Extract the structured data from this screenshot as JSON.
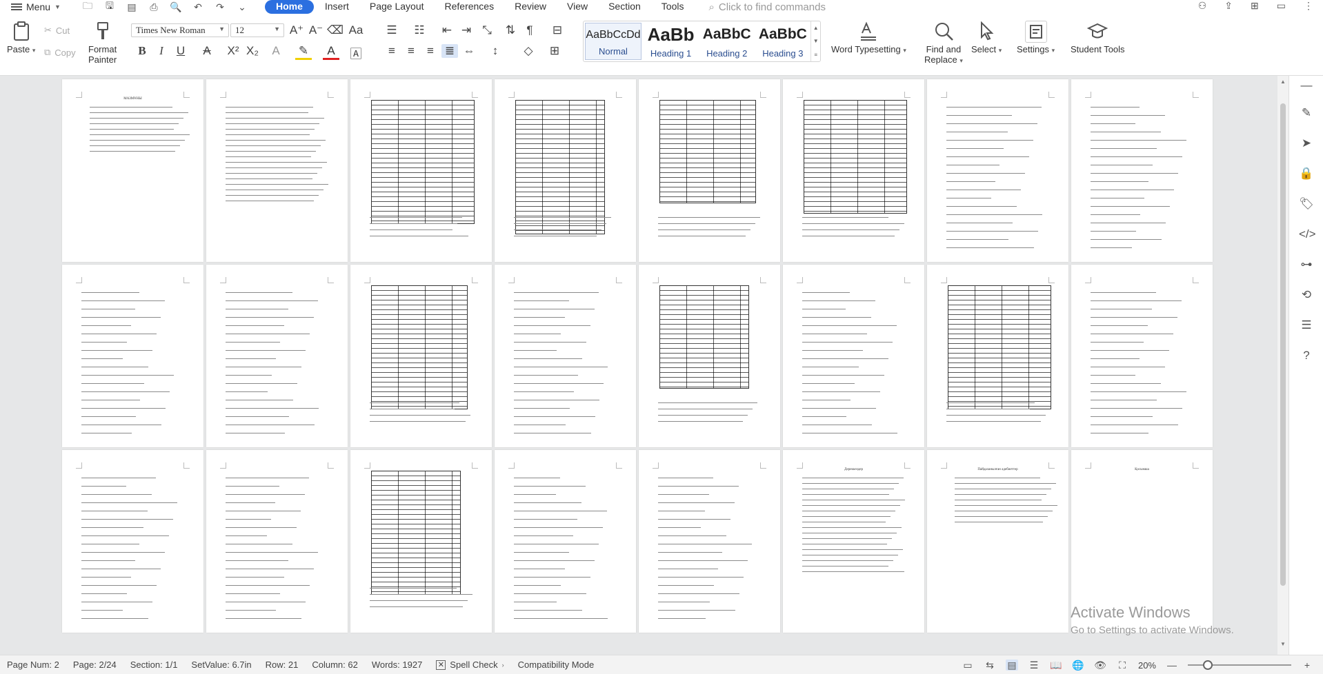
{
  "app": {
    "menu_label": "Menu",
    "tabs": [
      {
        "label": "Home",
        "active": true
      },
      {
        "label": "Insert"
      },
      {
        "label": "Page Layout"
      },
      {
        "label": "References"
      },
      {
        "label": "Review"
      },
      {
        "label": "View"
      },
      {
        "label": "Section"
      },
      {
        "label": "Tools"
      }
    ],
    "search_placeholder": "Click to find commands",
    "accent": "#2b6fe0"
  },
  "ribbon": {
    "paste": "Paste",
    "cut": "Cut",
    "copy": "Copy",
    "format_painter_1": "Format",
    "format_painter_2": "Painter",
    "font_name": "Times New Roman",
    "font_size": "12",
    "styles": [
      {
        "sample": "AaBbCcDd",
        "name": "Normal"
      },
      {
        "sample": "AaBb",
        "name": "Heading 1"
      },
      {
        "sample": "AaBbC",
        "name": "Heading 2"
      },
      {
        "sample": "AaBbC",
        "name": "Heading 3"
      }
    ],
    "word_typesetting": "Word Typesetting",
    "find_replace_1": "Find and",
    "find_replace_2": "Replace",
    "select": "Select",
    "settings": "Settings",
    "student_tools": "Student Tools"
  },
  "status": {
    "page_num": "Page Num: 2",
    "page": "Page: 2/24",
    "section": "Section: 1/1",
    "set_value": "SetValue: 6.7in",
    "row": "Row: 21",
    "column": "Column: 62",
    "words": "Words: 1927",
    "spell_check": "Spell Check",
    "compat": "Compatibility Mode",
    "zoom": "20%"
  },
  "watermark": {
    "line1": "Activate Windows",
    "line2": "Go to Settings to activate Windows."
  },
  "pages": {
    "p1_title": "МАЗМҰНЫ",
    "p17_title": "Дереккөздер",
    "p23_title": "Пайдаланылған әдебиеттер",
    "p24_title": "Қосымша"
  }
}
